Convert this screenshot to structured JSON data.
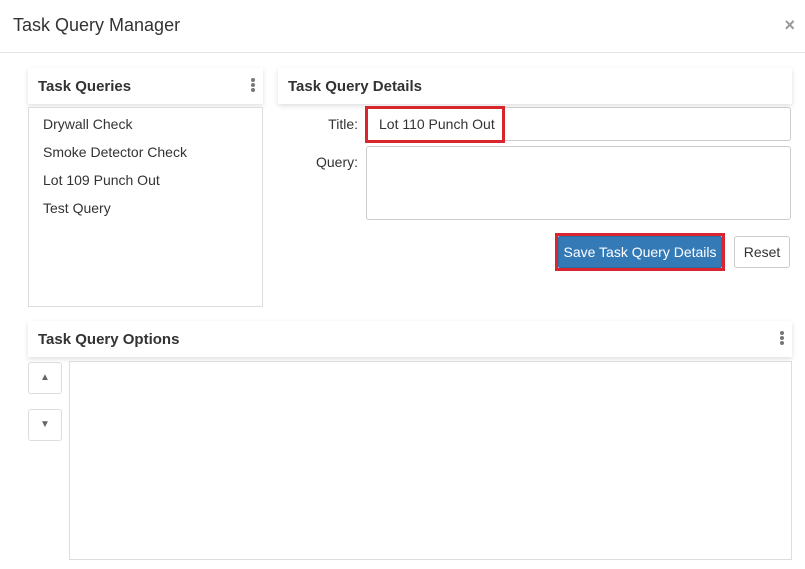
{
  "dialog": {
    "title": "Task Query Manager",
    "close_glyph": "×"
  },
  "queries_panel": {
    "title": "Task Queries",
    "items": [
      "Drywall Check",
      "Smoke Detector Check",
      "Lot 109 Punch Out",
      "Test Query"
    ]
  },
  "details_panel": {
    "title": "Task Query Details",
    "title_label": "Title:",
    "title_value": "Lot 110 Punch Out",
    "query_label": "Query:",
    "query_value": "",
    "save_label": "Save Task Query Details",
    "reset_label": "Reset"
  },
  "options_panel": {
    "title": "Task Query Options",
    "up_glyph": "▲",
    "down_glyph": "▼"
  },
  "colors": {
    "primary": "#337ab7",
    "highlight": "#d9262e"
  }
}
